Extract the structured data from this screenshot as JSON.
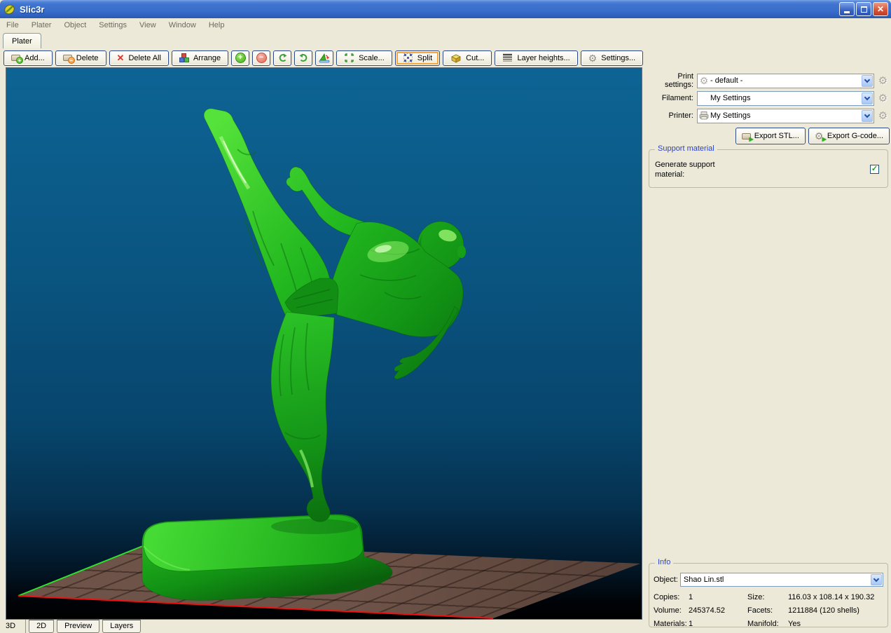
{
  "window": {
    "title": "Slic3r"
  },
  "icons": {
    "gear": "⚙",
    "check": "✓",
    "close": "✕",
    "x": "✕",
    "plus": "+",
    "minus": "−",
    "arrow": "▶"
  },
  "menu": {
    "items": [
      "File",
      "Plater",
      "Object",
      "Settings",
      "View",
      "Window",
      "Help"
    ]
  },
  "plater_tab": "Plater",
  "toolbar": {
    "add": "Add...",
    "delete": "Delete",
    "delete_all": "Delete All",
    "arrange": "Arrange",
    "scale": "Scale...",
    "split": "Split",
    "cut": "Cut...",
    "layer_heights": "Layer heights...",
    "settings": "Settings..."
  },
  "settings_panel": {
    "print_settings_label": "Print settings:",
    "print_settings_value": "- default -",
    "filament_label": "Filament:",
    "filament_value": "My Settings",
    "printer_label": "Printer:",
    "printer_value": "My Settings",
    "export_stl": "Export STL...",
    "export_gcode": "Export G-code..."
  },
  "support": {
    "title": "Support material",
    "label": "Generate support material:",
    "checked": true
  },
  "info": {
    "title": "Info",
    "object_label": "Object:",
    "object_value": "Shao Lin.stl",
    "fields": [
      {
        "label": "Copies:",
        "value": "1"
      },
      {
        "label": "Size:",
        "value": "116.03 x 108.14 x 190.32"
      },
      {
        "label": "Volume:",
        "value": "245374.52"
      },
      {
        "label": "Facets:",
        "value": "1211884 (120 shells)"
      },
      {
        "label": "Materials:",
        "value": "1"
      },
      {
        "label": "Manifold:",
        "value": "Yes"
      }
    ]
  },
  "bottom_tabs": {
    "items": [
      "3D",
      "2D",
      "Preview",
      "Layers"
    ],
    "active": "3D"
  },
  "colors": {
    "model_green": "#1fae1c",
    "bed_brown": "#6e5348",
    "axis_green": "#2de32d",
    "axis_red": "#ef1111",
    "viewport_top": "#0d6494",
    "titlebar_blue": "#3a6ecb",
    "accent_orange": "#f3a73d"
  }
}
